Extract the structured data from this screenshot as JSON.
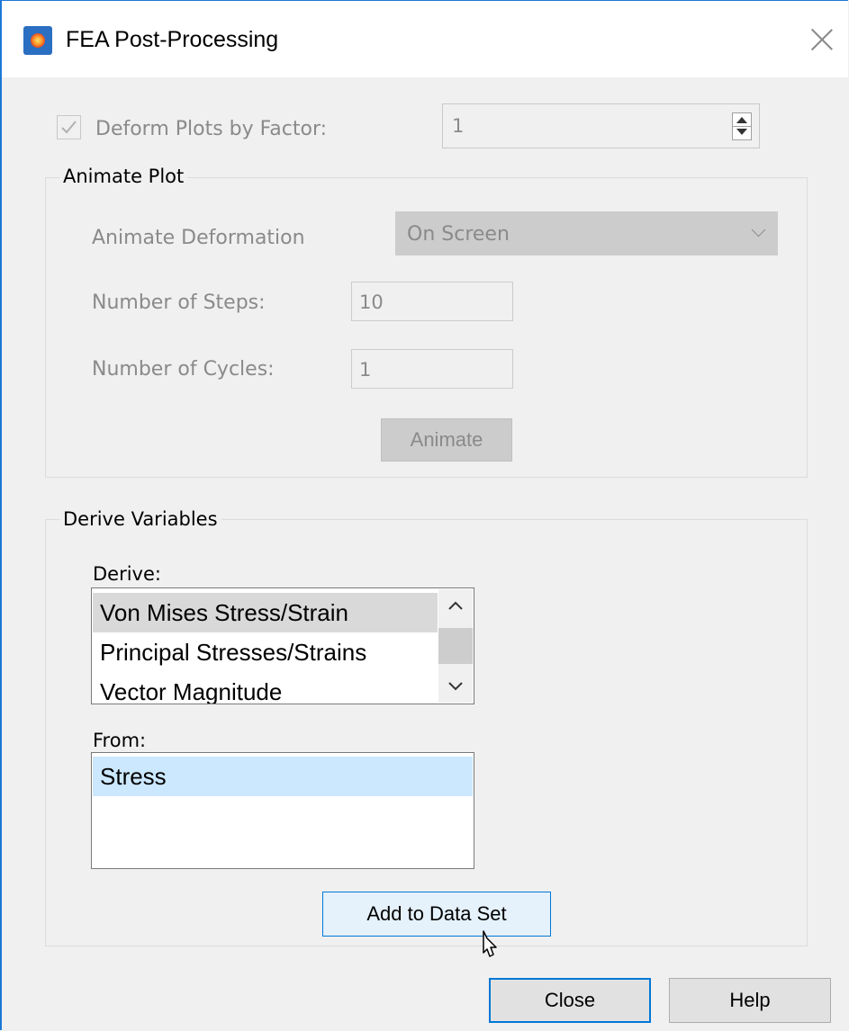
{
  "window": {
    "title": "FEA Post-Processing"
  },
  "deform": {
    "label": "Deform Plots by Factor:",
    "checked": true,
    "value": "1"
  },
  "animate_group": {
    "title": "Animate Plot",
    "deformation_label": "Animate Deformation",
    "deformation_value": "On Screen",
    "steps_label": "Number of Steps:",
    "steps_value": "10",
    "cycles_label": "Number of Cycles:",
    "cycles_value": "1",
    "animate_button": "Animate"
  },
  "derive_group": {
    "title": "Derive Variables",
    "derive_label": "Derive:",
    "derive_items": [
      "Von Mises Stress/Strain",
      "Principal Stresses/Strains",
      "Vector Magnitude"
    ],
    "derive_selected": "Von Mises Stress/Strain",
    "from_label": "From:",
    "from_items": [
      "Stress"
    ],
    "from_selected": "Stress",
    "add_button": "Add to Data Set"
  },
  "footer": {
    "close_button": "Close",
    "help_button": "Help"
  },
  "colors": {
    "accent": "#0078d7",
    "window_border": "#1c78d6",
    "disabled_text": "#8a8a8a",
    "selection": "#cce8ff"
  },
  "icons": [
    "app-icon",
    "close-icon",
    "checkmark-icon",
    "spin-up-icon",
    "spin-down-icon",
    "chevron-down-icon",
    "scroll-up-icon",
    "scroll-down-icon",
    "mouse-pointer-icon"
  ]
}
